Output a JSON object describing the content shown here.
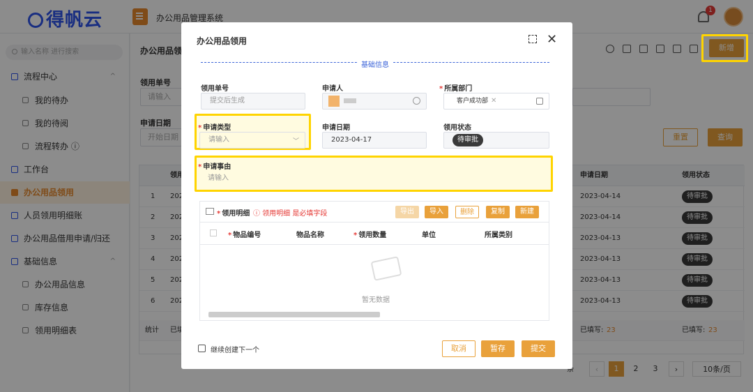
{
  "header": {
    "logo": "得帆云",
    "app_title": "办公用品管理系统",
    "notification_count": "1"
  },
  "sidebar": {
    "search_placeholder": "输入名称 进行搜索",
    "items": [
      {
        "label": "流程中心",
        "caret": "^"
      },
      {
        "label": "我的待办"
      },
      {
        "label": "我的待阅"
      },
      {
        "label": "流程转办 ⓘ"
      },
      {
        "label": "工作台"
      },
      {
        "label": "办公用品领用"
      },
      {
        "label": "人员领用明细账"
      },
      {
        "label": "办公用品借用申请/归还"
      },
      {
        "label": "基础信息",
        "caret": "^"
      },
      {
        "label": "办公用品信息"
      },
      {
        "label": "库存信息"
      },
      {
        "label": "领用明细表"
      }
    ]
  },
  "page": {
    "title": "办公用品领用",
    "new_button": "新增",
    "filters": {
      "order_label": "领用单号",
      "order_placeholder": "请输入",
      "date_label": "申请日期",
      "date_placeholder": "开始日期"
    },
    "reset_button": "重置",
    "query_button": "查询",
    "table": {
      "headers": [
        "领用",
        "申请日期",
        "领用状态"
      ],
      "rows": [
        {
          "idx": "1",
          "prefix": "202",
          "date": "2023-04-14",
          "status": "待审批"
        },
        {
          "idx": "2",
          "prefix": "202",
          "date": "2023-04-14",
          "status": "待审批"
        },
        {
          "idx": "3",
          "prefix": "202",
          "date": "2023-04-13",
          "status": "待审批"
        },
        {
          "idx": "4",
          "prefix": "202",
          "date": "2023-04-13",
          "status": "待审批"
        },
        {
          "idx": "5",
          "prefix": "202",
          "date": "2023-04-13",
          "status": "待审批"
        },
        {
          "idx": "6",
          "prefix": "202",
          "date": "2023-04-13",
          "status": "待审批"
        }
      ],
      "footer": {
        "stat": "统计",
        "filled_a": "已填写:",
        "filled_a_val": "23",
        "filled_b": "已填写:",
        "filled_b_val": "23",
        "col2": "已填"
      }
    },
    "pagination": {
      "total_suffix": "条",
      "pages": [
        "1",
        "2",
        "3"
      ],
      "current": "1",
      "page_size": "10条/页"
    }
  },
  "modal": {
    "title": "办公用品领用",
    "section": "基础信息",
    "fields": {
      "order_no": {
        "label": "领用单号",
        "placeholder": "提交后生成"
      },
      "applicant": {
        "label": "申请人"
      },
      "department": {
        "label": "所属部门",
        "tag": "客户成功部"
      },
      "apply_type": {
        "label": "申请类型",
        "placeholder": "请输入"
      },
      "apply_date": {
        "label": "申请日期",
        "value": "2023-04-17"
      },
      "status": {
        "label": "领用状态",
        "value": "待审批"
      },
      "reason": {
        "label": "申请事由",
        "placeholder": "请输入"
      }
    },
    "detail": {
      "title": "领用明细",
      "warning": "ⓘ 领用明细 是必填字段",
      "buttons": {
        "export": "导出",
        "import": "导入",
        "delete": "删除",
        "copy": "复制",
        "new": "新建"
      },
      "columns": [
        "物品编号",
        "物品名称",
        "领用数量",
        "单位",
        "所属类别"
      ],
      "empty": "暂无数据"
    },
    "continue_label": "继续创建下一个",
    "cancel_button": "取消",
    "save_button": "暂存",
    "submit_button": "提交"
  }
}
